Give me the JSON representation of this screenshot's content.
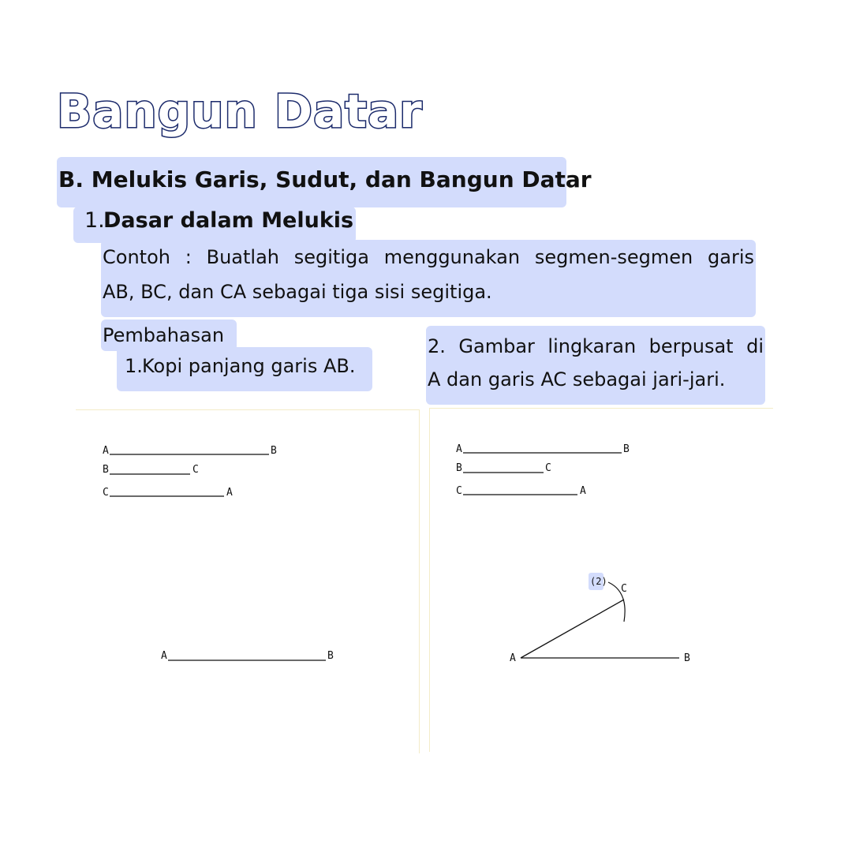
{
  "title": "Bangun Datar",
  "section": {
    "heading": "B. Melukis Garis, Sudut, dan Bangun Datar",
    "subsection": {
      "number": "1.",
      "title": "Dasar dalam Melukis"
    }
  },
  "example": {
    "line1": "Contoh : Buatlah segitiga menggunakan segmen-segmen garis",
    "line2": "AB, BC, dan CA sebagai tiga sisi segitiga."
  },
  "discussion": {
    "label": "Pembahasan",
    "step1": {
      "number": "1.",
      "text": "Kopi panjang garis AB."
    },
    "step2": {
      "line1": "2. Gambar lingkaran berpusat di",
      "line2": "A dan garis AC sebagai jari-jari."
    }
  },
  "figure_left": {
    "segments": [
      {
        "start": "A",
        "end": "B"
      },
      {
        "start": "B",
        "end": "C"
      },
      {
        "start": "C",
        "end": "A"
      }
    ],
    "copied_segment": {
      "start": "A",
      "end": "B"
    }
  },
  "figure_right": {
    "segments": [
      {
        "start": "A",
        "end": "B"
      },
      {
        "start": "B",
        "end": "C"
      },
      {
        "start": "C",
        "end": "A"
      }
    ],
    "step_marker": "(2)",
    "point_c": "C",
    "base_start": "A",
    "base_end": "B"
  },
  "colors": {
    "title_outline": "#1b2a6b",
    "highlight": "#d3dcfc",
    "panel_border": "#f4ecc8"
  }
}
